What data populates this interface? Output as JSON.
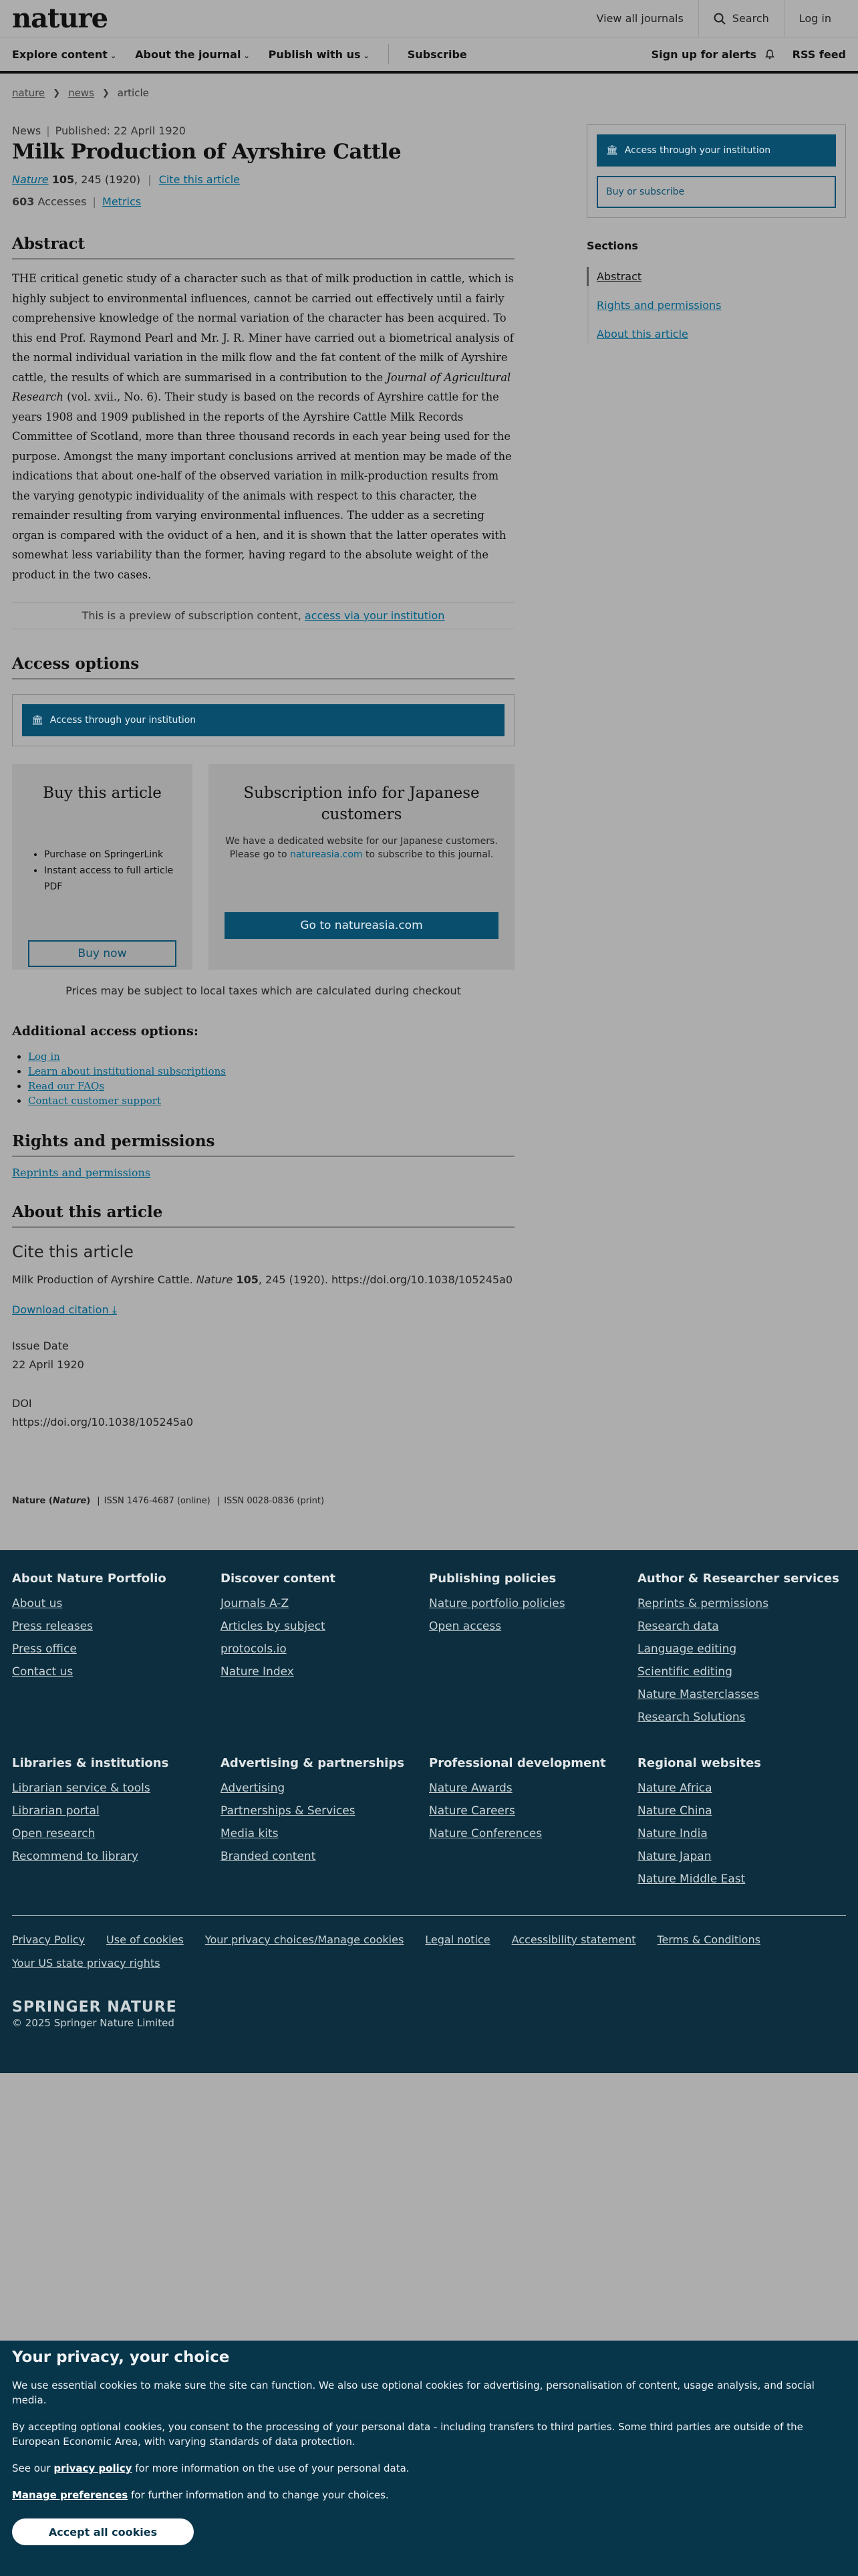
{
  "header": {
    "logo": "nature",
    "top_links": [
      "View all journals",
      "Search",
      "Log in"
    ],
    "nav": {
      "explore": "Explore content",
      "about": "About the journal",
      "publish": "Publish with us",
      "subscribe": "Subscribe",
      "alerts": "Sign up for alerts",
      "rss": "RSS feed"
    }
  },
  "breadcrumb": [
    "nature",
    "news",
    "article"
  ],
  "article": {
    "type": "News",
    "published": "Published: 22 April 1920",
    "title": "Milk Production of Ayrshire Cattle",
    "journal": "Nature",
    "volume": "105",
    "pages": ", 245 (1920)",
    "cite_link": "Cite this article",
    "accesses_count": "603",
    "accesses_label": "Accesses",
    "metrics_link": "Metrics"
  },
  "abstract": {
    "heading": "Abstract",
    "text_1": "THE critical genetic study of a character such as that of milk production in cattle, which is highly subject to environmental influences, cannot be carried out effectively until a fairly comprehensive knowledge of the normal variation of the character has been acquired. To this end Prof. Raymond Pearl and Mr. J. R. Miner have carried out a biometrical analysis of the normal individual variation in the milk flow and the fat content of the milk of Ayrshire cattle, the results of which are summarised in a contribution to the ",
    "journal_ref": "Journal of Agricultural Research",
    "text_2": " (vol. xvii., No. 6). Their study is based on the records of Ayrshire cattle for the years 1908 and 1909 published in the reports of the Ayrshire Cattle Milk Records Committee of Scotland, more than three thousand records in each year being used for the purpose. Amongst the many important conclusions arrived at mention may be made of the indications that about one-half of the observed variation in milk-production results from the varying genotypic individuality of the animals with respect to this character, the remainder resulting from varying environmental influences. The udder as a secreting organ is compared with the oviduct of a hen, and it is shown that the latter operates with somewhat less variability than the former, having regard to the absolute weight of the product in the two cases."
  },
  "preview": {
    "text": "This is a preview of subscription content, ",
    "link": "access via your institution"
  },
  "access_options": {
    "heading": "Access options",
    "institution_button": "Access through your institution",
    "buy": {
      "heading": "Buy this article",
      "bullets": [
        "Purchase on SpringerLink",
        "Instant access to full article PDF"
      ],
      "button": "Buy now"
    },
    "japan": {
      "heading": "Subscription info for Japanese customers",
      "desc_1": "We have a dedicated website for our Japanese customers. Please go to ",
      "desc_link": "natureasia.com",
      "desc_2": " to subscribe to this journal.",
      "button": "Go to natureasia.com"
    },
    "prices_note": "Prices may be subject to local taxes which are calculated during checkout"
  },
  "additional": {
    "heading": "Additional access options:",
    "links": [
      "Log in",
      "Learn about institutional subscriptions",
      "Read our FAQs",
      "Contact customer support"
    ]
  },
  "rights": {
    "heading": "Rights and permissions",
    "link": "Reprints and permissions"
  },
  "about": {
    "heading": "About this article",
    "cite_heading": "Cite this article",
    "cite_text_1": "Milk Production of Ayrshire Cattle. ",
    "cite_journal": "Nature",
    "cite_volume": "105",
    "cite_text_2": ", 245 (1920). https://doi.org/10.1038/105245a0",
    "download": "Download citation",
    "issue_date_label": "Issue Date",
    "issue_date": "22 April 1920",
    "doi_label": "DOI",
    "doi": "https://doi.org/10.1038/105245a0"
  },
  "issn": {
    "name": "Nature",
    "name_italic": "Nature",
    "online": "ISSN 1476-4687 (online)",
    "print": "ISSN 0028-0836 (print)"
  },
  "sidebar": {
    "institution_button": "Access through your institution",
    "buy_button": "Buy or subscribe",
    "sections_heading": "Sections",
    "sections": [
      "Abstract",
      "Rights and permissions",
      "About this article"
    ]
  },
  "footer": {
    "columns": [
      {
        "heading": "About Nature Portfolio",
        "links": [
          "About us",
          "Press releases",
          "Press office",
          "Contact us"
        ]
      },
      {
        "heading": "Discover content",
        "links": [
          "Journals A-Z",
          "Articles by subject",
          "protocols.io",
          "Nature Index"
        ]
      },
      {
        "heading": "Publishing policies",
        "links": [
          "Nature portfolio policies",
          "Open access"
        ]
      },
      {
        "heading": "Author & Researcher services",
        "links": [
          "Reprints & permissions",
          "Research data",
          "Language editing",
          "Scientific editing",
          "Nature Masterclasses",
          "Research Solutions"
        ]
      }
    ],
    "columns2": [
      {
        "heading": "Libraries & institutions",
        "links": [
          "Librarian service & tools",
          "Librarian portal",
          "Open research",
          "Recommend to library"
        ]
      },
      {
        "heading": "Advertising & partnerships",
        "links": [
          "Advertising",
          "Partnerships & Services",
          "Media kits",
          "Branded content"
        ]
      },
      {
        "heading": "Professional development",
        "links": [
          "Nature Awards",
          "Nature Careers",
          "Nature Conferences"
        ]
      },
      {
        "heading": "Regional websites",
        "links": [
          "Nature Africa",
          "Nature China",
          "Nature India",
          "Nature Japan",
          "Nature Middle East"
        ]
      }
    ],
    "legal": [
      "Privacy Policy",
      "Use of cookies",
      "Your privacy choices/Manage cookies",
      "Legal notice",
      "Accessibility statement",
      "Terms & Conditions",
      "Your US state privacy rights"
    ],
    "brand": "SPRINGER NATURE",
    "copyright": "© 2025 Springer Nature Limited"
  },
  "cookie": {
    "heading": "Your privacy, your choice",
    "p1": "We use essential cookies to make sure the site can function. We also use optional cookies for advertising, personalisation of content, usage analysis, and social media.",
    "p2": "By accepting optional cookies, you consent to the processing of your personal data - including transfers to third parties. Some third parties are outside of the European Economic Area, with varying standards of data protection.",
    "p3_a": "See our ",
    "p3_link": "privacy policy",
    "p3_b": " for more information on the use of your personal data.",
    "p4_link": "Manage preferences",
    "p4_b": " for further information and to change your choices.",
    "accept": "Accept all cookies"
  }
}
